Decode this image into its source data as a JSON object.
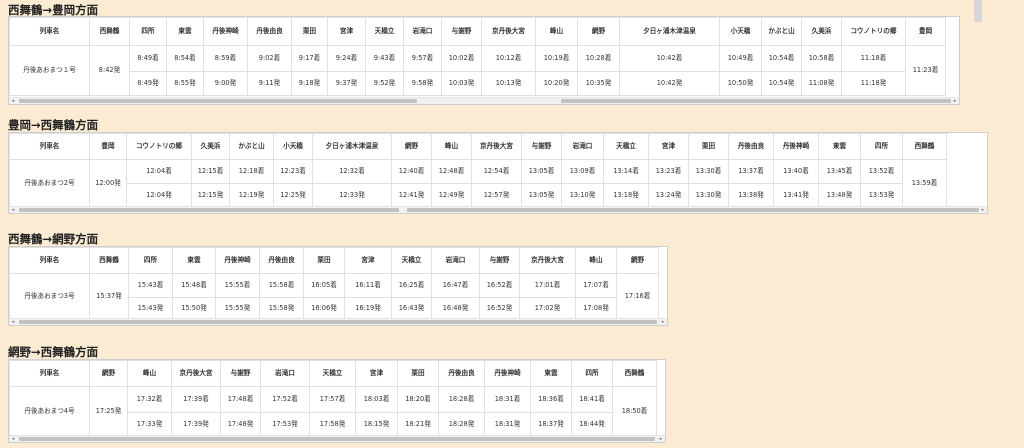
{
  "colors": {
    "background": "#fcebd3",
    "table_bg": "#ffffff",
    "grid": "#e0e0e0",
    "scrollbar_thumb": "#c2c2c2"
  },
  "icons": {
    "scroll_left": "triangle-left-icon",
    "scroll_right": "triangle-right-icon"
  },
  "sections": [
    {
      "title": "西舞鶴→豊岡方面",
      "headers": [
        "列車名",
        "西舞鶴",
        "四所",
        "東雲",
        "丹後神崎",
        "丹後由良",
        "栗田",
        "宮津",
        "天橋立",
        "岩滝口",
        "与謝野",
        "京丹後大宮",
        "峰山",
        "網野",
        "夕日ヶ浦木津温泉",
        "小天橋",
        "かぶと山",
        "久美浜",
        "コウノトリの郷",
        "豊岡"
      ],
      "train": "丹後あおまつ１号",
      "first": "8:42発",
      "arrivals": [
        "8:49着",
        "8:54着",
        "8:59着",
        "9:02着",
        "9:17着",
        "9:24着",
        "9:43着",
        "9:57着",
        "10:02着",
        "10:12着",
        "10:19着",
        "10:28着",
        "10:42着",
        "10:49着",
        "10:54着",
        "10:58着",
        "11:18着"
      ],
      "departures": [
        "8:49発",
        "8:55発",
        "9:00発",
        "9:11発",
        "9:18発",
        "9:37発",
        "9:52発",
        "9:58発",
        "10:03発",
        "10:13発",
        "10:20発",
        "10:35発",
        "10:42発",
        "10:50発",
        "10:54発",
        "11:08発",
        "11:18発"
      ],
      "last": "11:23着"
    },
    {
      "title": "豊岡→西舞鶴方面",
      "headers": [
        "列車名",
        "豊岡",
        "コウノトリの郷",
        "久美浜",
        "かぶと山",
        "小天橋",
        "夕日ヶ浦木津温泉",
        "網野",
        "峰山",
        "京丹後大宮",
        "与謝野",
        "岩滝口",
        "天橋立",
        "宮津",
        "栗田",
        "丹後由良",
        "丹後神崎",
        "東雲",
        "四所",
        "西舞鶴"
      ],
      "train": "丹後あおまつ2号",
      "first": "12:00発",
      "arrivals": [
        "12:04着",
        "12:15着",
        "12:18着",
        "12:23着",
        "12:32着",
        "12:40着",
        "12:48着",
        "12:54着",
        "13:05着",
        "13:09着",
        "13:14着",
        "13:23着",
        "13:30着",
        "13:37着",
        "13:40着",
        "13:45着",
        "13:52着"
      ],
      "departures": [
        "12:04発",
        "12:15発",
        "12:19発",
        "12:25発",
        "12:33発",
        "12:41発",
        "12:49発",
        "12:57発",
        "13:05発",
        "13:10発",
        "13:18発",
        "13:24発",
        "13:30発",
        "13:38発",
        "13:41発",
        "13:48発",
        "13:53発"
      ],
      "last": "13:59着"
    },
    {
      "title": "西舞鶴→網野方面",
      "headers": [
        "列車名",
        "西舞鶴",
        "四所",
        "東雲",
        "丹後神崎",
        "丹後由良",
        "栗田",
        "宮津",
        "天橋立",
        "岩滝口",
        "与謝野",
        "京丹後大宮",
        "峰山",
        "網野"
      ],
      "train": "丹後あおまつ3号",
      "first": "15:37発",
      "arrivals": [
        "15:43着",
        "15:48着",
        "15:55着",
        "15:58着",
        "16:05着",
        "16:11着",
        "16:25着",
        "16:47着",
        "16:52着",
        "17:01着",
        "17:07着"
      ],
      "departures": [
        "15:43発",
        "15:50発",
        "15:55発",
        "15:58発",
        "16:06発",
        "16:19発",
        "16:43発",
        "16:48発",
        "16:52発",
        "17:02発",
        "17:08発"
      ],
      "last": "17:16着"
    },
    {
      "title": "網野→西舞鶴方面",
      "headers": [
        "列車名",
        "網野",
        "峰山",
        "京丹後大宮",
        "与謝野",
        "岩滝口",
        "天橋立",
        "宮津",
        "栗田",
        "丹後由良",
        "丹後神崎",
        "東雲",
        "四所",
        "西舞鶴"
      ],
      "train": "丹後あおまつ4号",
      "first": "17:25発",
      "arrivals": [
        "17:32着",
        "17:39着",
        "17:48着",
        "17:52着",
        "17:57着",
        "18:03着",
        "18:20着",
        "18:28着",
        "18:31着",
        "18:36着",
        "18:41着"
      ],
      "departures": [
        "17:33発",
        "17:39発",
        "17:48発",
        "17:53発",
        "17:58発",
        "18:15発",
        "18:21発",
        "18:28発",
        "18:31発",
        "18:37発",
        "18:44発"
      ],
      "last": "18:50着"
    }
  ]
}
